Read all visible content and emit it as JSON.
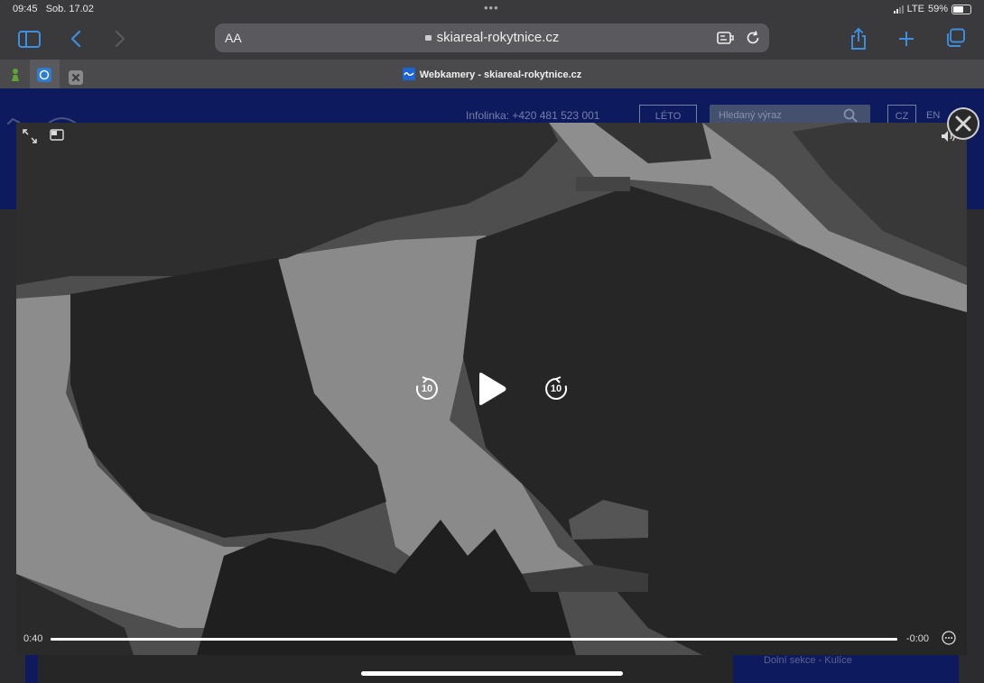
{
  "status_bar": {
    "time": "09:45",
    "date": "Sob. 17.02",
    "network": "LTE",
    "battery": "59%"
  },
  "toolbar": {
    "text_size": "AA",
    "domain": "skiareal-rokytnice.cz"
  },
  "tab_bar": {
    "title": "Webkamery - skiareal-rokytnice.cz"
  },
  "page": {
    "infolinka": "Infolinka: +420 481 523 001",
    "leto_label": "LÉTO",
    "search_placeholder": "Hledaný výraz",
    "lang_cz": "CZ",
    "lang_en": "EN",
    "side_text": "Dolní sekce - Kulíce"
  },
  "player": {
    "elapsed": "0:40",
    "remaining": "-0:00",
    "skip_back": "10",
    "skip_forward": "10",
    "progress": 1.0
  },
  "colors": {
    "accent": "#3d8fe0",
    "site_band": "#0d1a5e"
  }
}
